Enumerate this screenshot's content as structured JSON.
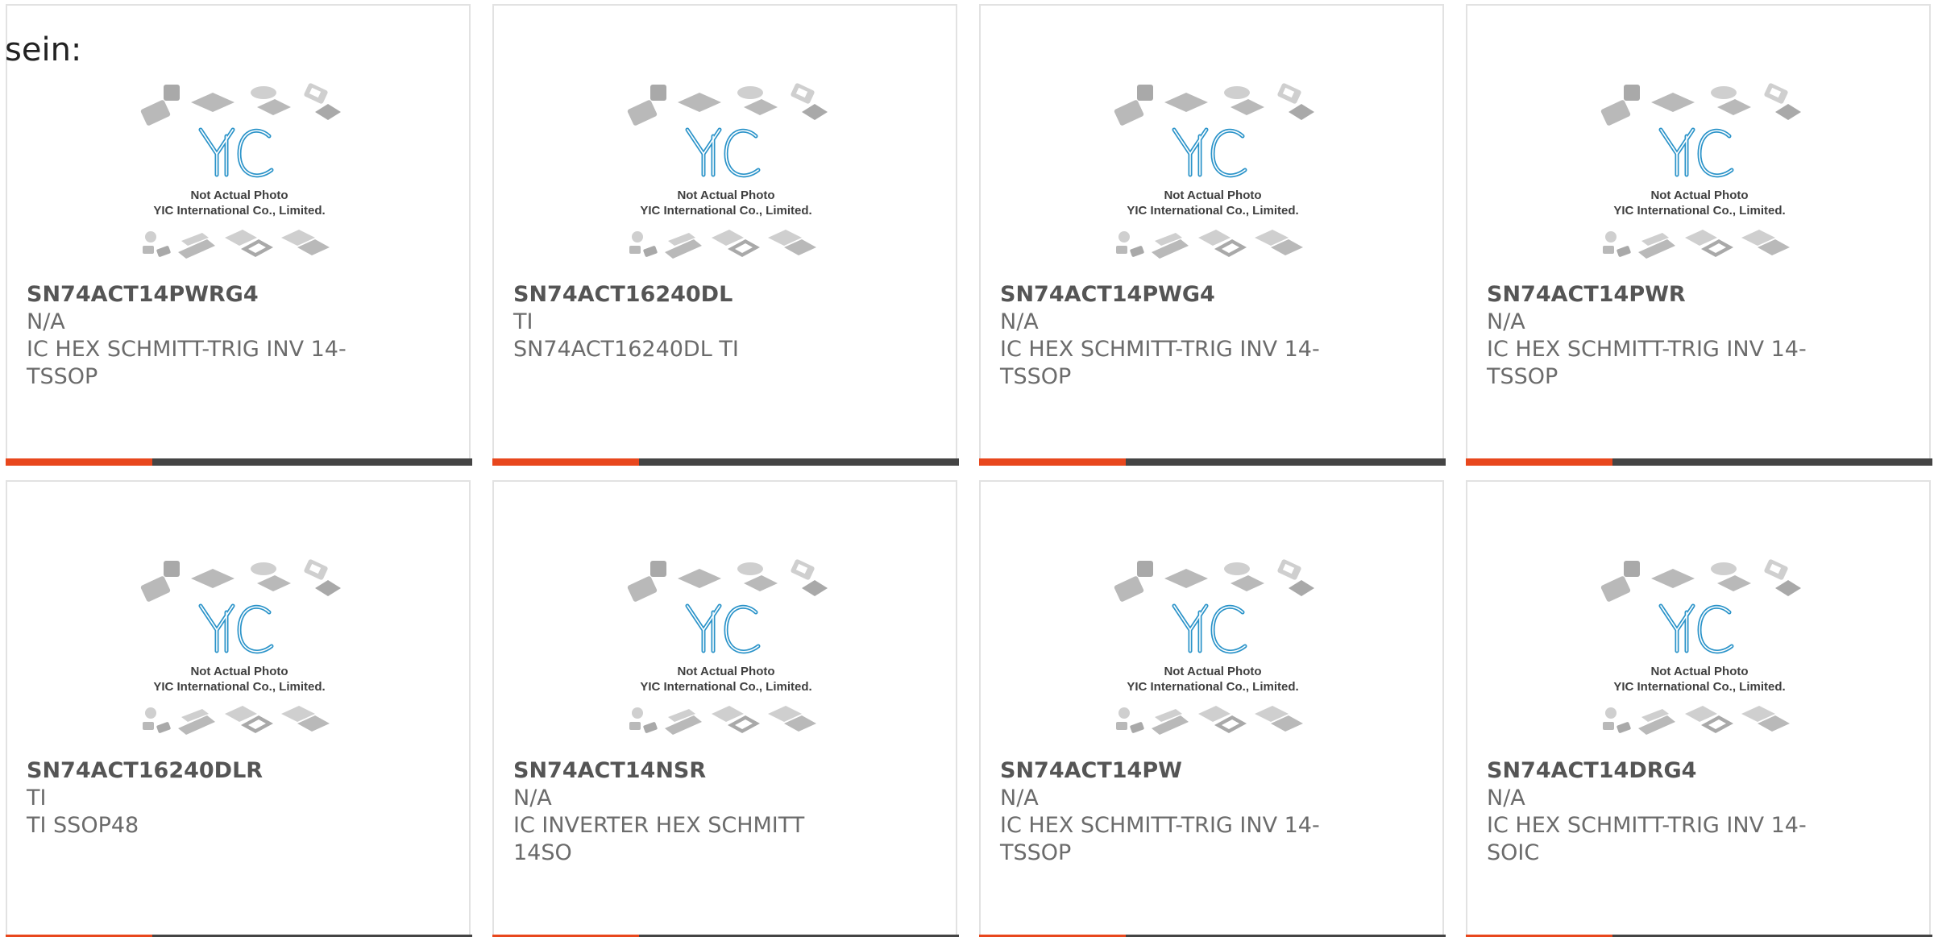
{
  "heading": "sein:",
  "placeholder": {
    "line1": "Not Actual Photo",
    "line2": "YIC International Co., Limited.",
    "logo": "YIC"
  },
  "colors": {
    "accent": "#e8471d",
    "bar": "#444444",
    "logo_blue": "#2a93c9",
    "border": "#e2e2e2"
  },
  "products": [
    {
      "part": "SN74ACT14PWRG4",
      "brand": "N/A",
      "desc": "IC HEX SCHMITT-TRIG INV 14-TSSOP"
    },
    {
      "part": "SN74ACT16240DL",
      "brand": "TI",
      "desc": "SN74ACT16240DL TI"
    },
    {
      "part": "SN74ACT14PWG4",
      "brand": "N/A",
      "desc": "IC HEX SCHMITT-TRIG INV 14-TSSOP"
    },
    {
      "part": "SN74ACT14PWR",
      "brand": "N/A",
      "desc": "IC HEX SCHMITT-TRIG INV 14-TSSOP"
    },
    {
      "part": "SN74ACT16240DLR",
      "brand": "TI",
      "desc": "TI SSOP48"
    },
    {
      "part": "SN74ACT14NSR",
      "brand": "N/A",
      "desc": "IC INVERTER HEX SCHMITT 14SO"
    },
    {
      "part": "SN74ACT14PW",
      "brand": "N/A",
      "desc": "IC HEX SCHMITT-TRIG INV 14-TSSOP"
    },
    {
      "part": "SN74ACT14DRG4",
      "brand": "N/A",
      "desc": "IC HEX SCHMITT-TRIG INV 14-SOIC"
    }
  ]
}
